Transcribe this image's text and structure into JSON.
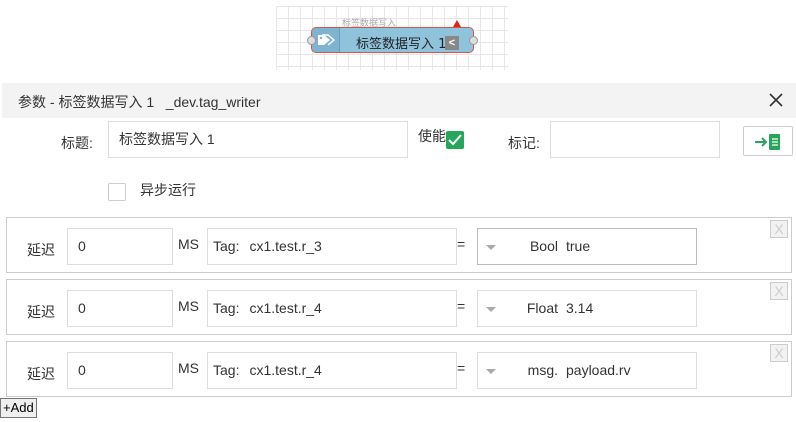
{
  "node": {
    "caption": "标签数据写入",
    "label": "标签数据写入 1",
    "button_glyph": "<",
    "icon": "tags-icon"
  },
  "header": {
    "title": "参数 - 标签数据写入 1",
    "type_name": "_dev.tag_writer",
    "close_icon": "✕"
  },
  "form": {
    "title_label": "标题:",
    "title_value": "标签数据写入 1",
    "enabled_label": "使能",
    "enabled": true,
    "mark_label": "标记:",
    "mark_value": "",
    "async_label": "异步运行",
    "async": false
  },
  "rows": [
    {
      "delay_label": "延迟",
      "delay": "0",
      "ms_label": "MS",
      "tag_prefix": "Tag:",
      "tag": "cx1.test.r_3",
      "eq": "=",
      "type": "Bool",
      "value": "true"
    },
    {
      "delay_label": "延迟",
      "delay": "0",
      "ms_label": "MS",
      "tag_prefix": "Tag:",
      "tag": "cx1.test.r_4",
      "eq": "=",
      "type": "Float",
      "value": "3.14"
    },
    {
      "delay_label": "延迟",
      "delay": "0",
      "ms_label": "MS",
      "tag_prefix": "Tag:",
      "tag": "cx1.test.r_4",
      "eq": "=",
      "type": "msg.",
      "value": "payload.rv"
    }
  ],
  "remove_glyph": "X",
  "add_label": "+Add",
  "colors": {
    "accent": "#26a65b",
    "node_fill": "#8fc3dc",
    "node_border": "#d9534f",
    "header_bg": "#f3f3f3"
  }
}
